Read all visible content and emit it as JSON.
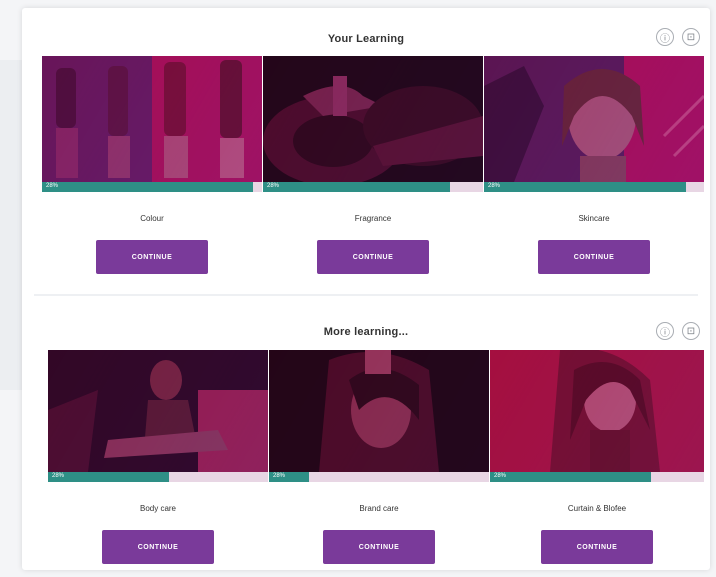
{
  "colors": {
    "accent_button": "#7a3a9a",
    "progress": "#2e8f86",
    "overlay": "#bd1266"
  },
  "icons": {
    "info": "info-icon",
    "expand": "expand-icon"
  },
  "sections": [
    {
      "title": "Your Learning",
      "icon_info": "ⓘ",
      "icon_expand": "⊡",
      "tiles": [
        {
          "title": "Colour",
          "cta": "CONTINUE",
          "progress_label": "28%",
          "progress": 0.96
        },
        {
          "title": "Fragrance",
          "cta": "CONTINUE",
          "progress_label": "28%",
          "progress": 0.85
        },
        {
          "title": "Skincare",
          "cta": "CONTINUE",
          "progress_label": "28%",
          "progress": 0.92
        }
      ]
    },
    {
      "title": "More learning...",
      "icon_info": "ⓘ",
      "icon_expand": "⊡",
      "tiles": [
        {
          "title": "Body care",
          "cta": "CONTINUE",
          "progress_label": "28%",
          "progress": 0.55
        },
        {
          "title": "Brand care",
          "cta": "CONTINUE",
          "progress_label": "28%",
          "progress": 0.18
        },
        {
          "title": "Curtain & Blofee",
          "cta": "CONTINUE",
          "progress_label": "28%",
          "progress": 0.75
        }
      ]
    }
  ]
}
